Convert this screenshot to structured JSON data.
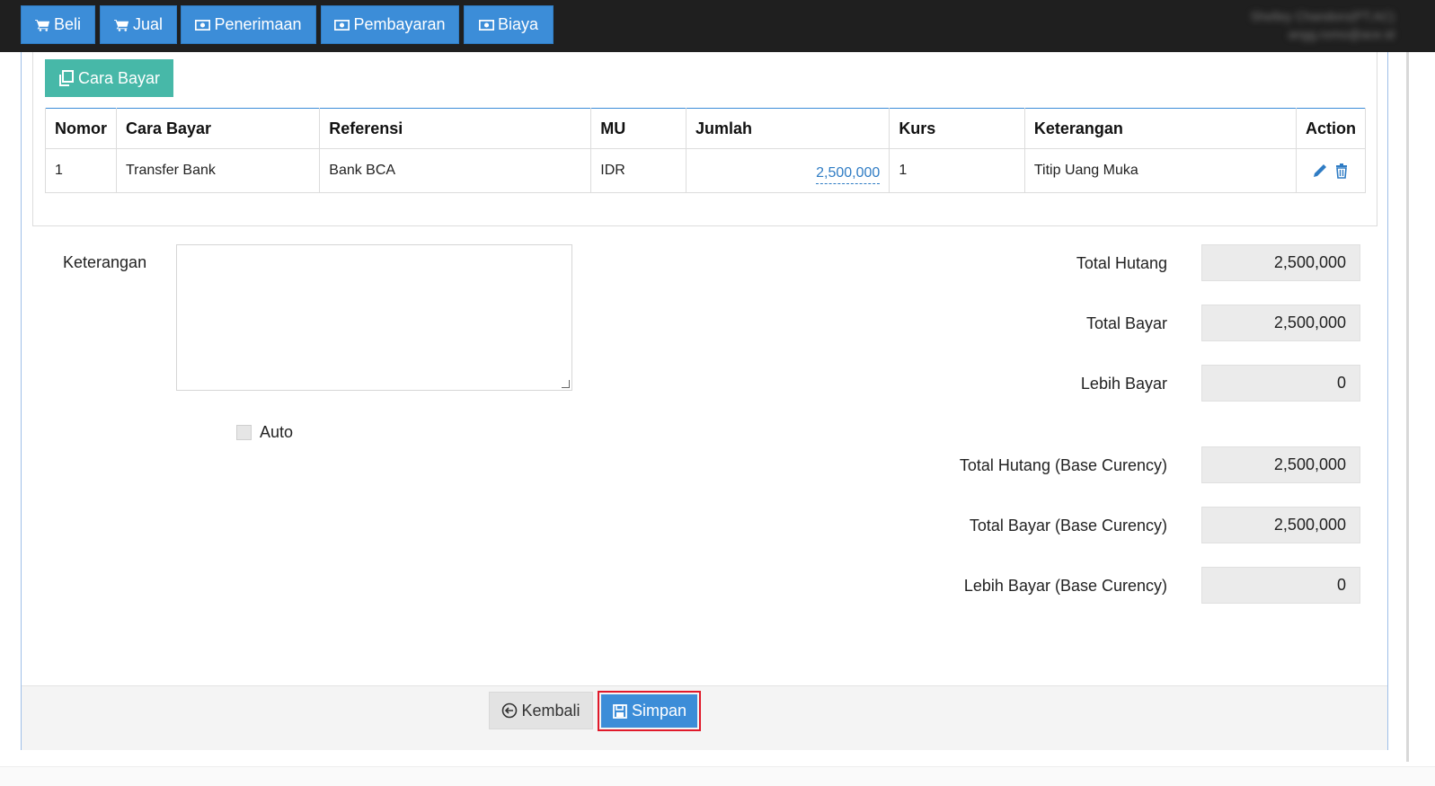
{
  "topnav": {
    "buttons": [
      {
        "label": "Beli",
        "icon": "cart-icon"
      },
      {
        "label": "Jual",
        "icon": "cart-icon"
      },
      {
        "label": "Penerimaan",
        "icon": "money-icon"
      },
      {
        "label": "Pembayaran",
        "icon": "money-icon"
      },
      {
        "label": "Biaya",
        "icon": "money-icon"
      }
    ],
    "user_line1": "Shelley Chandoro(PT.AC)",
    "user_line2": "angg.romo@ace.id"
  },
  "payments": {
    "add_button": "Cara Bayar",
    "columns": [
      "Nomor",
      "Cara Bayar",
      "Referensi",
      "MU",
      "Jumlah",
      "Kurs",
      "Keterangan",
      "Action"
    ],
    "rows": [
      {
        "nomor": "1",
        "cara_bayar": "Transfer Bank",
        "referensi": "Bank BCA",
        "mu": "IDR",
        "jumlah": "2,500,000",
        "kurs": "1",
        "keterangan": "Titip Uang Muka"
      }
    ]
  },
  "form": {
    "keterangan_label": "Keterangan",
    "keterangan_value": "",
    "auto_label": "Auto",
    "auto_checked": false
  },
  "summary": [
    {
      "label": "Total Hutang",
      "value": "2,500,000"
    },
    {
      "label": "Total Bayar",
      "value": "2,500,000"
    },
    {
      "label": "Lebih Bayar",
      "value": "0"
    },
    {
      "label": "Total Hutang (Base Curency)",
      "value": "2,500,000"
    },
    {
      "label": "Total Bayar (Base Curency)",
      "value": "2,500,000"
    },
    {
      "label": "Lebih Bayar (Base Curency)",
      "value": "0"
    }
  ],
  "footer": {
    "back_label": "Kembali",
    "save_label": "Simpan"
  },
  "colors": {
    "primary": "#3c8dd8",
    "teal": "#47b8a8",
    "topbar": "#1f1f1f",
    "highlight": "#e0192a"
  }
}
